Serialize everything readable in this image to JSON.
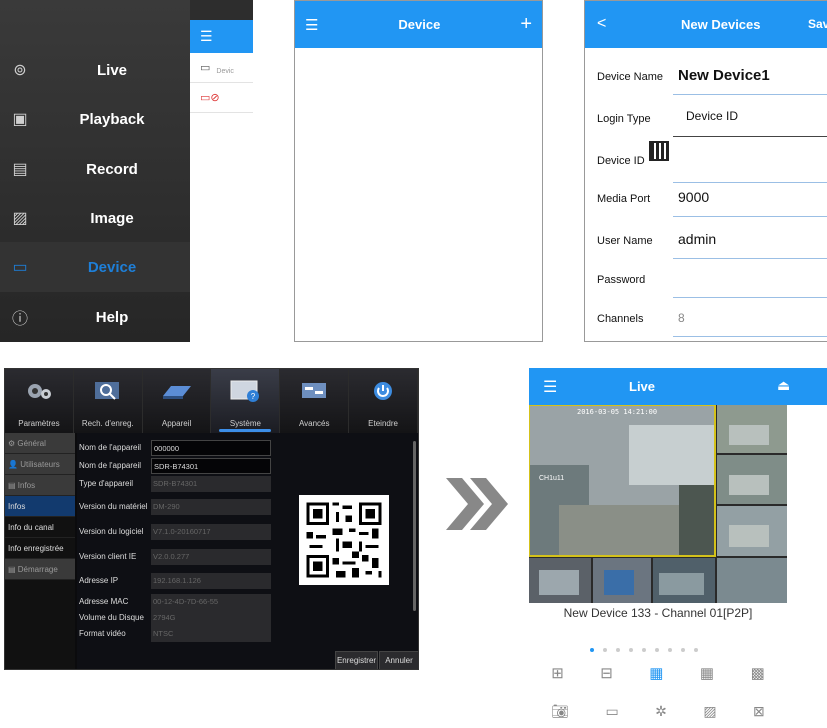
{
  "side_menu": {
    "items": [
      {
        "label": "Live",
        "icon": "camera-icon"
      },
      {
        "label": "Playback",
        "icon": "playback-icon"
      },
      {
        "label": "Record",
        "icon": "record-icon"
      },
      {
        "label": "Image",
        "icon": "image-icon"
      },
      {
        "label": "Device",
        "icon": "dvr-icon",
        "active": true
      },
      {
        "label": "Help",
        "icon": "info-icon"
      }
    ],
    "list_row_text": "Devic"
  },
  "device_list": {
    "title": "Device",
    "add_icon": "plus-icon",
    "menu_icon": "hamburger-icon"
  },
  "new_device": {
    "title": "New Devices",
    "save_label": "Save",
    "fields": {
      "device_name": {
        "label": "Device Name",
        "value": "New Device1"
      },
      "login_type": {
        "label": "Login Type",
        "value": "Device ID"
      },
      "device_id": {
        "label": "Device ID",
        "value": ""
      },
      "media_port": {
        "label": "Media Port",
        "value": "9000"
      },
      "user_name": {
        "label": "User Name",
        "value": "admin"
      },
      "password": {
        "label": "Password",
        "value": ""
      },
      "channels": {
        "label": "Channels",
        "value": "8"
      }
    }
  },
  "dvr": {
    "tabs": [
      "Paramètres",
      "Rech. d'enreg.",
      "Appareil",
      "Système",
      "Avancés",
      "Eteindre"
    ],
    "active_tab": "Système",
    "sidebar": [
      "Général",
      "Utilisateurs",
      "Infos",
      "Infos",
      "Info du canal",
      "Info enregistrée",
      "Démarrage"
    ],
    "fields": [
      {
        "label": "Nom de l'appareil",
        "value": "000000"
      },
      {
        "label": "Nom de l'appareil",
        "value": "SDR-B74301"
      },
      {
        "label": "Type d'appareil",
        "value": "SDR-B74301"
      },
      {
        "label": "Version du matériel",
        "value": "DM-290"
      },
      {
        "label": "Version du  logiciel",
        "value": "V7.1.0-20160717"
      },
      {
        "label": "Version client IE",
        "value": "V2.0.0.277"
      },
      {
        "label": "Adresse IP",
        "value": "192.168.1.126"
      },
      {
        "label": "Adresse MAC",
        "value": "00-12-4D-7D-66-55"
      },
      {
        "label": "Volume du Disque",
        "value": "2794G"
      },
      {
        "label": "Format vidéo",
        "value": "NTSC"
      }
    ],
    "save_label": "Enregistrer",
    "cancel_label": "Annuler"
  },
  "live": {
    "title": "Live",
    "timestamp": "2016-03-05 14:21:00",
    "overlay_label": "CH1u11",
    "caption": "New Device 133 - Channel 01[P2P]",
    "page_dots": 9,
    "active_dot": 0
  }
}
